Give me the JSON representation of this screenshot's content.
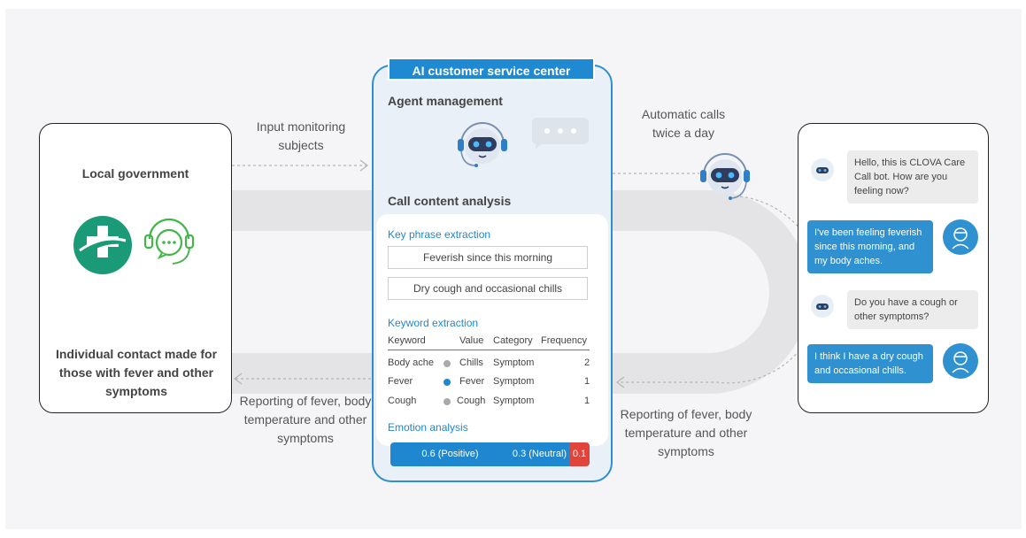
{
  "left": {
    "title": "Local government",
    "bottom_text": "Individual contact made for those with fever and other symptoms"
  },
  "flows": {
    "input_monitoring": "Input monitoring subjects",
    "reporting_left": "Reporting of fever, body temperature and other symptoms",
    "automatic_calls": "Automatic calls twice a day",
    "reporting_right": "Reporting of fever, body temperature and other symptoms"
  },
  "center": {
    "header": "AI customer service center",
    "agent_management": "Agent management",
    "call_content_analysis": "Call content analysis",
    "key_phrase_title": "Key phrase extraction",
    "key_phrases": [
      "Feverish since this morning",
      "Dry cough and occasional chills"
    ],
    "keyword_title": "Keyword extraction",
    "keyword_headers": [
      "Keyword",
      "Value",
      "Category",
      "Frequency"
    ],
    "keywords": [
      {
        "keyword": "Body ache",
        "value": "Chills",
        "category": "Symptom",
        "frequency": "2",
        "dot_color": "#aaaaaa"
      },
      {
        "keyword": "Fever",
        "value": "Fever",
        "category": "Symptom",
        "frequency": "1",
        "dot_color": "#1f87d0"
      },
      {
        "keyword": "Cough",
        "value": "Cough",
        "category": "Symptom",
        "frequency": "1",
        "dot_color": "#aaaaaa"
      }
    ],
    "emotion_title": "Emotion analysis",
    "emotion": {
      "positive_label": "0.6 (Positive)",
      "neutral_label": "0.3 (Neutral)",
      "negative_label": "0.1",
      "positive": 0.6,
      "neutral": 0.3,
      "negative": 0.1,
      "colors": {
        "positive": "#1f87d0",
        "neutral": "#1f87d0",
        "negative": "#e0443a"
      }
    }
  },
  "chat": {
    "messages": [
      {
        "from": "bot",
        "text": "Hello, this is CLOVA Care Call bot. How are you feeling now?"
      },
      {
        "from": "user",
        "text": "I've been feeling feverish since this morning, and my body aches."
      },
      {
        "from": "bot",
        "text": "Do you have a cough or other symptoms?"
      },
      {
        "from": "user",
        "text": "I think I have a dry cough and occasional chills."
      }
    ]
  },
  "colors": {
    "accent": "#1f87d0",
    "negative": "#e0443a",
    "logo_green": "#1a9a76",
    "headset_green": "#43b649"
  }
}
